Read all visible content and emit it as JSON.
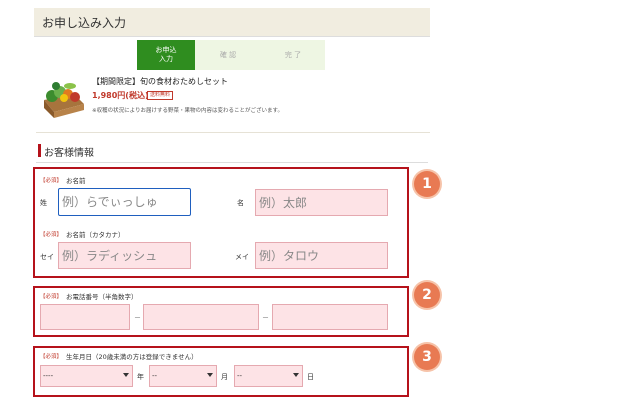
{
  "page": {
    "title": "お申し込み入力"
  },
  "steps": [
    {
      "label": "お申込入力",
      "label_line1": "お申込",
      "label_line2": "入力",
      "active": true
    },
    {
      "label": "確 認",
      "active": false
    },
    {
      "label": "完 了",
      "active": false
    }
  ],
  "product": {
    "title": "【期間限定】旬の食材おためしセット",
    "price": "1,980円(税込)",
    "shipping_badge": "送料無料",
    "note": "※収穫の状況によりお届けする野菜・果物の内容は変わることがございます。"
  },
  "section": {
    "title": "お客様情報"
  },
  "form": {
    "name": {
      "required": "【必須】",
      "label": "お名前",
      "sei_label": "姓",
      "mei_label": "名",
      "sei_placeholder": "例）らでぃっしゅ",
      "mei_placeholder": "例）太郎"
    },
    "kana": {
      "required": "【必須】",
      "label": "お名前（カタカナ）",
      "sei_label": "セイ",
      "mei_label": "メイ",
      "sei_placeholder": "例）ラディッシュ",
      "mei_placeholder": "例）タロウ"
    },
    "phone": {
      "required": "【必須】",
      "label": "お電話番号（半角数字）",
      "separator": "－"
    },
    "birthday": {
      "required": "【必須】",
      "label": "生年月日（20歳未満の方は登録できません）",
      "year_value": "----",
      "month_value": "--",
      "day_value": "--",
      "year_unit": "年",
      "month_unit": "月",
      "day_unit": "日"
    }
  },
  "markers": [
    "1",
    "2",
    "3"
  ],
  "colors": {
    "accent_red": "#b5121b",
    "step_green": "#2f8d1f",
    "input_pink": "#fde3e6",
    "marker_orange": "#e87a53"
  }
}
